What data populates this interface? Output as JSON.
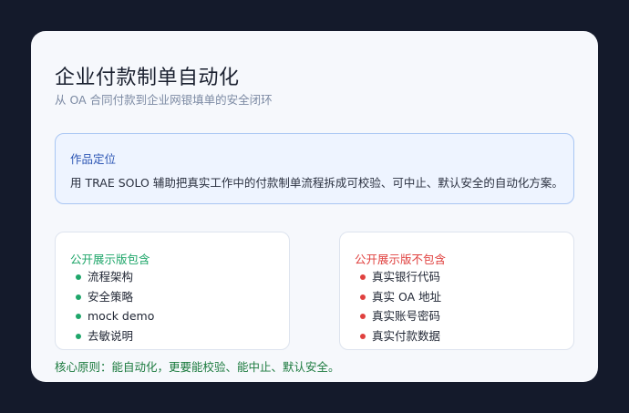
{
  "slide": {
    "title": "企业付款制单自动化",
    "subtitle": "从 OA 合同付款到企业网银填单的安全闭环"
  },
  "positioning": {
    "heading": "作品定位",
    "description": "用 TRAE SOLO 辅助把真实工作中的付款制单流程拆成可校验、可中止、默认安全的自动化方案。"
  },
  "included": {
    "title": "公开展示版包含",
    "items": [
      "流程架构",
      "安全策略",
      "mock demo",
      "去敏说明"
    ]
  },
  "excluded": {
    "title": "公开展示版不包含",
    "items": [
      "真实银行代码",
      "真实 OA 地址",
      "真实账号密码",
      "真实付款数据"
    ]
  },
  "principle": "核心原则：能自动化，更要能校验、能中止、默认安全。",
  "colors": {
    "background": "#141a2b",
    "card": "#f6f8fc",
    "included_accent": "#1fa66a",
    "excluded_accent": "#e0413f",
    "heading_blue": "#2d56b4",
    "principle_green": "#1b7a3e"
  }
}
